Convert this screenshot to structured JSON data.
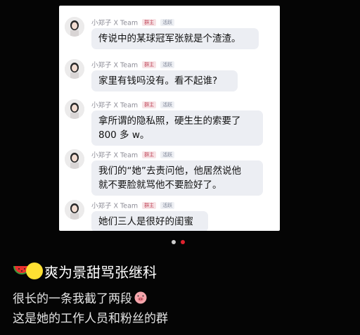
{
  "chat": {
    "messages": [
      {
        "sender": "小郑子 X Team",
        "role_tag": "群主",
        "activity_tag": "活跃",
        "text": "传说中的某球冠军张就是个渣渣。"
      },
      {
        "sender": "小郑子 X Team",
        "role_tag": "群主",
        "activity_tag": "活跃",
        "text": "家里有钱吗没有。看不起谁?"
      },
      {
        "sender": "小郑子 X Team",
        "role_tag": "群主",
        "activity_tag": "活跃",
        "text_lines": [
          "拿所谓的隐私照，硬生生的索要了",
          "800 多 w。"
        ]
      },
      {
        "sender": "小郑子 X Team",
        "role_tag": "群主",
        "activity_tag": "活跃",
        "text_lines": [
          "我们的“她”去责问他，他居然说他",
          "就不要脸就骂他不要脸好了。"
        ]
      },
      {
        "sender": "小郑子 X Team",
        "role_tag": "群主",
        "activity_tag": "活跃",
        "text": "她们三人是很好的闺蜜"
      }
    ]
  },
  "carousel": {
    "count": 2,
    "active_index": 1,
    "active_color": "#e0222e",
    "inactive_color": "#cfcfcf"
  },
  "post": {
    "title": "爽为景甜骂张继科",
    "title_emojis": [
      "watermelon-icon",
      "smiley-face-icon"
    ],
    "lines": [
      "很长的一条我截了两段",
      "这是她的工作人员和粉丝的群"
    ],
    "line1_emoji": "pig-face-icon"
  },
  "colors": {
    "background": "#050505",
    "bubble": "#eceef3",
    "owner_tag": "#c2485a"
  }
}
